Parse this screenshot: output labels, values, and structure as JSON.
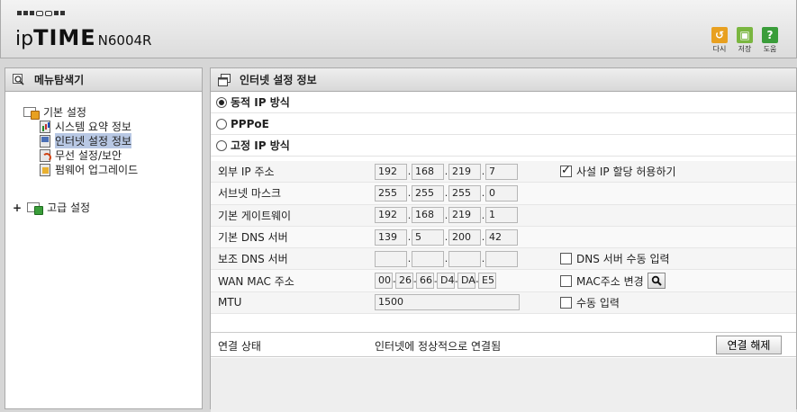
{
  "header": {
    "brand_ip": "ip",
    "brand_time": "TIME",
    "model": "N6004R",
    "tools": [
      {
        "label": "다시",
        "icon": "reset-icon",
        "color": "#e8a020",
        "glyph": "↺"
      },
      {
        "label": "저장",
        "icon": "save-icon",
        "color": "#7ab640",
        "glyph": "▣"
      },
      {
        "label": "도움",
        "icon": "help-icon",
        "color": "#3a9d3a",
        "glyph": "?"
      }
    ]
  },
  "sidebar": {
    "title": "메뉴탐색기",
    "groups": [
      {
        "label": "기본 설정",
        "items": [
          "시스템 요약 정보",
          "인터넷 설정 정보",
          "무선 설정/보안",
          "펌웨어 업그레이드"
        ]
      },
      {
        "label": "고급 설정"
      }
    ],
    "expand_symbol": "+"
  },
  "main": {
    "title": "인터넷 설정 정보",
    "modes": [
      {
        "label": "동적 IP 방식",
        "selected": true
      },
      {
        "label": "PPPoE",
        "selected": false
      },
      {
        "label": "고정 IP 방식",
        "selected": false
      }
    ],
    "fields": {
      "external_ip": {
        "label": "외부 IP 주소",
        "octets": [
          "192",
          "168",
          "219",
          "7"
        ]
      },
      "subnet_mask": {
        "label": "서브넷 마스크",
        "octets": [
          "255",
          "255",
          "255",
          "0"
        ]
      },
      "gateway": {
        "label": "기본 게이트웨이",
        "octets": [
          "192",
          "168",
          "219",
          "1"
        ]
      },
      "dns_primary": {
        "label": "기본 DNS 서버",
        "octets": [
          "139",
          "5",
          "200",
          "42"
        ]
      },
      "dns_secondary": {
        "label": "보조 DNS 서버",
        "octets": [
          "",
          "",
          "",
          ""
        ]
      },
      "wan_mac": {
        "label": "WAN MAC 주소",
        "bytes": [
          "00",
          "26",
          "66",
          "D4",
          "DA",
          "E5"
        ]
      },
      "mtu": {
        "label": "MTU",
        "value": "1500"
      }
    },
    "options": {
      "private_ip": {
        "label": "사설 IP 할당 허용하기",
        "checked": true
      },
      "dns_manual": {
        "label": "DNS 서버 수동 입력",
        "checked": false
      },
      "mac_change": {
        "label": "MAC주소 변경",
        "checked": false
      },
      "mtu_manual": {
        "label": "수동 입력",
        "checked": false
      }
    },
    "status": {
      "label": "연결 상태",
      "value": "인터넷에 정상적으로 연결됨",
      "button": "연결 해제"
    }
  }
}
